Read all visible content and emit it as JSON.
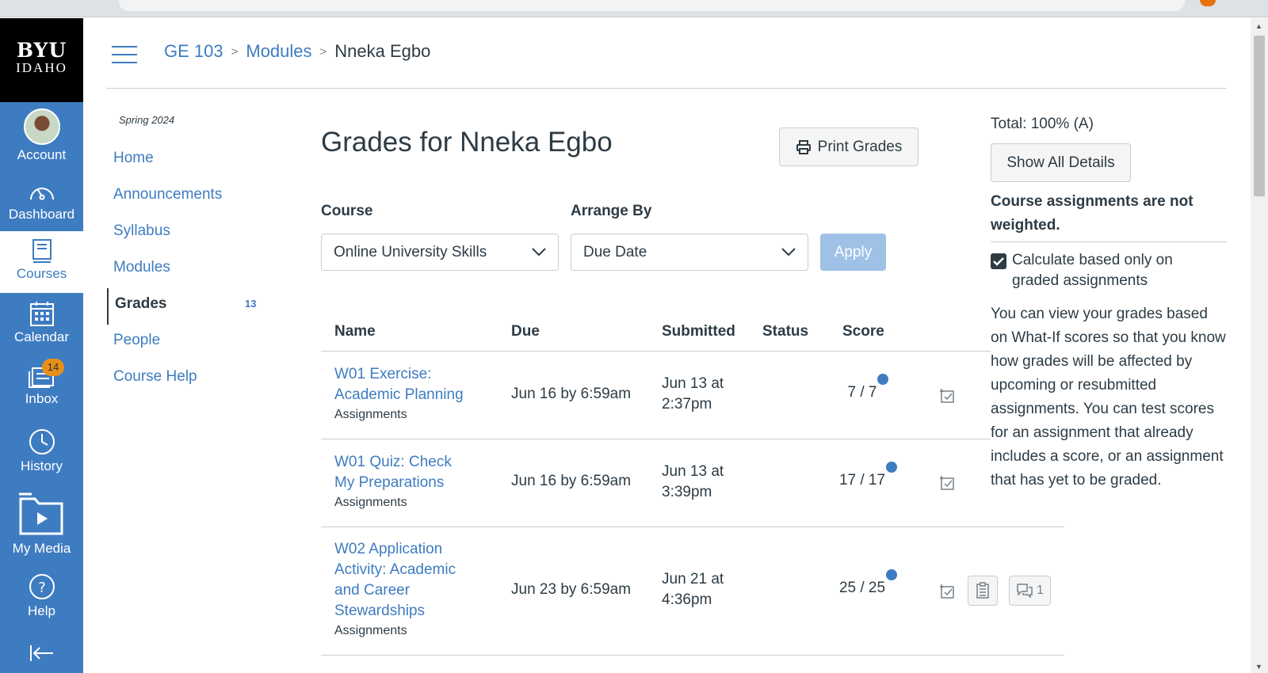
{
  "global_nav": {
    "logo_line1": "BYU",
    "logo_line2": "IDAHO",
    "items": [
      {
        "label": "Account",
        "icon": "avatar"
      },
      {
        "label": "Dashboard",
        "icon": "dashboard-icon"
      },
      {
        "label": "Courses",
        "icon": "courses-icon"
      },
      {
        "label": "Calendar",
        "icon": "calendar-icon"
      },
      {
        "label": "Inbox",
        "icon": "inbox-icon",
        "badge": "14"
      },
      {
        "label": "History",
        "icon": "history-icon"
      },
      {
        "label": "My Media",
        "icon": "my-media-icon"
      },
      {
        "label": "Help",
        "icon": "help-icon"
      }
    ]
  },
  "breadcrumb": {
    "course": "GE 103",
    "section": "Modules",
    "current": "Nneka Egbo"
  },
  "course_nav": {
    "term": "Spring 2024",
    "items": [
      {
        "label": "Home"
      },
      {
        "label": "Announcements"
      },
      {
        "label": "Syllabus"
      },
      {
        "label": "Modules"
      },
      {
        "label": "Grades",
        "count": "13"
      },
      {
        "label": "People"
      },
      {
        "label": "Course Help"
      }
    ]
  },
  "main": {
    "title": "Grades for Nneka Egbo",
    "print_button": "Print Grades",
    "course_label": "Course",
    "course_value": "Online University Skills",
    "arrange_label": "Arrange By",
    "arrange_value": "Due Date",
    "apply_button": "Apply"
  },
  "table": {
    "headers": {
      "name": "Name",
      "due": "Due",
      "submitted": "Submitted",
      "status": "Status",
      "score": "Score"
    },
    "rows": [
      {
        "name_line1": "W01 Exercise:",
        "name_line2": "Academic Planning",
        "category": "Assignments",
        "due": "Jun 16 by 6:59am",
        "submitted_line1": "Jun 13 at",
        "submitted_line2": "2:37pm",
        "status": "",
        "score": "7 / 7"
      },
      {
        "name_line1": "W01 Quiz: Check",
        "name_line2": "My Preparations",
        "category": "Assignments",
        "due": "Jun 16 by 6:59am",
        "submitted_line1": "Jun 13 at",
        "submitted_line2": "3:39pm",
        "status": "",
        "score": "17 / 17"
      },
      {
        "name_line1": "W02 Application",
        "name_line2": "Activity: Academic",
        "name_line3": "and Career",
        "name_line4": "Stewardships",
        "category": "Assignments",
        "due": "Jun 23 by 6:59am",
        "submitted_line1": "Jun 21 at",
        "submitted_line2": "4:36pm",
        "status": "",
        "score": "25 / 25",
        "comments": "1"
      }
    ]
  },
  "sidebar": {
    "total": "Total: 100% (A)",
    "show_details_button": "Show All Details",
    "not_weighted": "Course assignments are not weighted.",
    "checkbox_label": "Calculate based only on graded assignments",
    "checkbox_checked": true,
    "whatif_text": "You can view your grades based on What-If scores so that you know how grades will be affected by upcoming or resubmitted assignments. You can test scores for an assignment that already includes a score, or an assignment that has yet to be graded."
  },
  "colors": {
    "brand": "#3e7cc1",
    "apply_disabled": "#9fc1e6",
    "badge": "#e8901b"
  }
}
